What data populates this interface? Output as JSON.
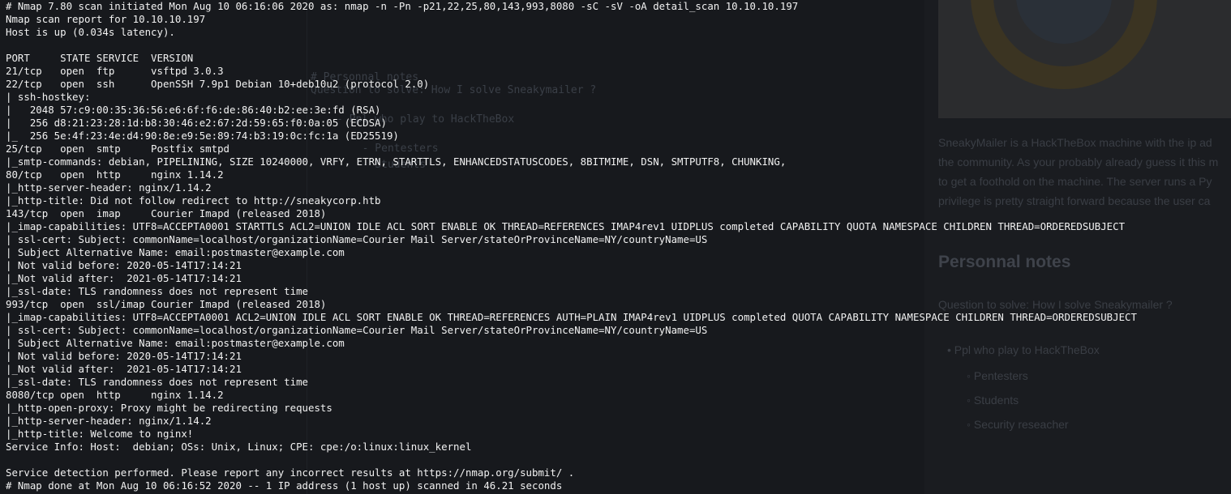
{
  "background_editor": {
    "ghost_lines": [
      "# Personnal notes",
      "Question to solve: How I solve Sneakymailer ?",
      "- Ppl who play to HackTheBox",
      "  - Pentesters",
      "  - Students"
    ]
  },
  "background_preview": {
    "paragraph_lines": [
      "SneakyMailer is a HackTheBox machine with the ip ad",
      "the community. As your probably already guess it this m",
      "to get a foothold on the machine. The server runs a Py",
      "privilege is pretty straight forward because the user ca"
    ],
    "heading": "Personnal notes",
    "question": "Question to solve: How I solve Sneakymailer ?",
    "list_top": "Ppl who play to HackTheBox",
    "list_sub": [
      "Pentesters",
      "Students",
      "Security reseacher"
    ]
  },
  "terminal": {
    "lines": [
      "# Nmap 7.80 scan initiated Mon Aug 10 06:16:06 2020 as: nmap -n -Pn -p21,22,25,80,143,993,8080 -sC -sV -oA detail_scan 10.10.10.197",
      "Nmap scan report for 10.10.10.197",
      "Host is up (0.034s latency).",
      "",
      "PORT     STATE SERVICE  VERSION",
      "21/tcp   open  ftp      vsftpd 3.0.3",
      "22/tcp   open  ssh      OpenSSH 7.9p1 Debian 10+deb10u2 (protocol 2.0)",
      "| ssh-hostkey:",
      "|   2048 57:c9:00:35:36:56:e6:6f:f6:de:86:40:b2:ee:3e:fd (RSA)",
      "|   256 d8:21:23:28:1d:b8:30:46:e2:67:2d:59:65:f0:0a:05 (ECDSA)",
      "|_  256 5e:4f:23:4e:d4:90:8e:e9:5e:89:74:b3:19:0c:fc:1a (ED25519)",
      "25/tcp   open  smtp     Postfix smtpd",
      "|_smtp-commands: debian, PIPELINING, SIZE 10240000, VRFY, ETRN, STARTTLS, ENHANCEDSTATUSCODES, 8BITMIME, DSN, SMTPUTF8, CHUNKING,",
      "80/tcp   open  http     nginx 1.14.2",
      "|_http-server-header: nginx/1.14.2",
      "|_http-title: Did not follow redirect to http://sneakycorp.htb",
      "143/tcp  open  imap     Courier Imapd (released 2018)",
      "|_imap-capabilities: UTF8=ACCEPTA0001 STARTTLS ACL2=UNION IDLE ACL SORT ENABLE OK THREAD=REFERENCES IMAP4rev1 UIDPLUS completed CAPABILITY QUOTA NAMESPACE CHILDREN THREAD=ORDEREDSUBJECT",
      "| ssl-cert: Subject: commonName=localhost/organizationName=Courier Mail Server/stateOrProvinceName=NY/countryName=US",
      "| Subject Alternative Name: email:postmaster@example.com",
      "| Not valid before: 2020-05-14T17:14:21",
      "|_Not valid after:  2021-05-14T17:14:21",
      "|_ssl-date: TLS randomness does not represent time",
      "993/tcp  open  ssl/imap Courier Imapd (released 2018)",
      "|_imap-capabilities: UTF8=ACCEPTA0001 ACL2=UNION IDLE ACL SORT ENABLE OK THREAD=REFERENCES AUTH=PLAIN IMAP4rev1 UIDPLUS completed QUOTA CAPABILITY NAMESPACE CHILDREN THREAD=ORDEREDSUBJECT",
      "| ssl-cert: Subject: commonName=localhost/organizationName=Courier Mail Server/stateOrProvinceName=NY/countryName=US",
      "| Subject Alternative Name: email:postmaster@example.com",
      "| Not valid before: 2020-05-14T17:14:21",
      "|_Not valid after:  2021-05-14T17:14:21",
      "|_ssl-date: TLS randomness does not represent time",
      "8080/tcp open  http     nginx 1.14.2",
      "|_http-open-proxy: Proxy might be redirecting requests",
      "|_http-server-header: nginx/1.14.2",
      "|_http-title: Welcome to nginx!",
      "Service Info: Host:  debian; OSs: Unix, Linux; CPE: cpe:/o:linux:linux_kernel",
      "",
      "Service detection performed. Please report any incorrect results at https://nmap.org/submit/ .",
      "# Nmap done at Mon Aug 10 06:16:52 2020 -- 1 IP address (1 host up) scanned in 46.21 seconds"
    ]
  }
}
